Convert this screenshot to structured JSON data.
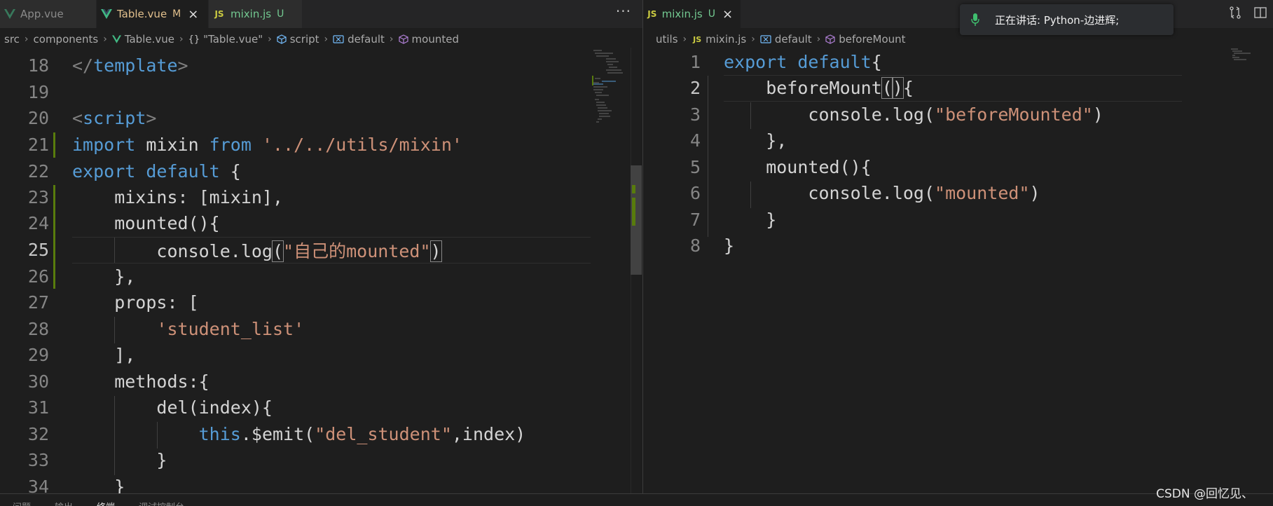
{
  "left": {
    "tabs": [
      {
        "label": "App.vue",
        "status": "",
        "icon": "vue-icon",
        "active": false
      },
      {
        "label": "Table.vue",
        "status": "M",
        "icon": "vue-icon",
        "active": true
      },
      {
        "label": "mixin.js",
        "status": "U",
        "icon": "js-icon",
        "active": false
      }
    ],
    "more": "···",
    "breadcrumb": [
      "src",
      "components",
      "Table.vue",
      "\"Table.vue\"",
      "script",
      "default",
      "mounted"
    ],
    "bc_icons": [
      "",
      "",
      "vue-icon",
      "{}",
      "cube-icon",
      "variable-icon",
      "method-icon"
    ],
    "current_line": 25
  },
  "right": {
    "tabs": [
      {
        "label": "mixin.js",
        "status": "U",
        "icon": "js-icon",
        "active": true
      }
    ],
    "breadcrumb": [
      "utils",
      "mixin.js",
      "default",
      "beforeMount"
    ],
    "current_line": 2
  },
  "popup": {
    "text": "正在讲话: Python-边进辉;",
    "icon": "microphone-icon"
  },
  "bottom_tabs": [
    "问题",
    "输出",
    "终端",
    "调试控制台"
  ],
  "watermark": "CSDN @回忆见、",
  "icons": {
    "js_badge": "JS",
    "close": "×",
    "braces": "{}"
  },
  "colors": {
    "keyword": "#569cd6",
    "string": "#ce9178",
    "tag": "#808080",
    "text": "#d4d4d4",
    "added": "#587c0c"
  }
}
